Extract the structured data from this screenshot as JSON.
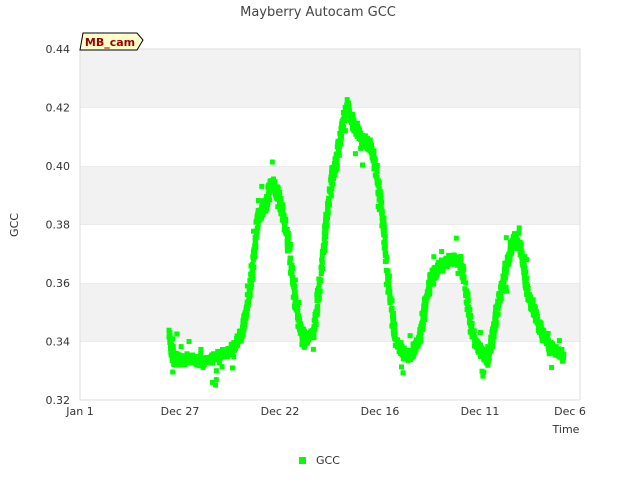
{
  "chart_data": {
    "type": "scatter",
    "title": "Mayberry Autocam GCC",
    "xlabel": "Time",
    "ylabel": "GCC",
    "x_tick_labels": [
      "Jan 1",
      "Dec 27",
      "Dec 22",
      "Dec 16",
      "Dec 11",
      "Dec 6"
    ],
    "y_tick_labels": [
      "0.32",
      "0.34",
      "0.36",
      "0.38",
      "0.40",
      "0.42",
      "0.44"
    ],
    "ylim": [
      0.32,
      0.44
    ],
    "xlim_days": [
      0,
      31
    ],
    "grid": "horizontal alternating bands",
    "legend_position": "bottom-center",
    "annotation": "MB_cam",
    "marker_color": "#00ff00",
    "series": [
      {
        "name": "GCC",
        "profile": [
          [
            5.5,
            0.3425
          ],
          [
            5.8,
            0.3345
          ],
          [
            6.3,
            0.3335
          ],
          [
            7.0,
            0.334
          ],
          [
            7.5,
            0.333
          ],
          [
            8.0,
            0.3335
          ],
          [
            8.5,
            0.335
          ],
          [
            9.0,
            0.336
          ],
          [
            9.5,
            0.338
          ],
          [
            10.0,
            0.342
          ],
          [
            10.5,
            0.356
          ],
          [
            10.8,
            0.37
          ],
          [
            11.0,
            0.382
          ],
          [
            11.5,
            0.387
          ],
          [
            11.9,
            0.394
          ],
          [
            12.3,
            0.39
          ],
          [
            12.7,
            0.38
          ],
          [
            13.0,
            0.37
          ],
          [
            13.3,
            0.356
          ],
          [
            13.6,
            0.345
          ],
          [
            14.0,
            0.34
          ],
          [
            14.5,
            0.344
          ],
          [
            14.8,
            0.356
          ],
          [
            15.2,
            0.378
          ],
          [
            15.6,
            0.395
          ],
          [
            16.0,
            0.405
          ],
          [
            16.3,
            0.415
          ],
          [
            16.6,
            0.42
          ],
          [
            17.0,
            0.414
          ],
          [
            17.5,
            0.409
          ],
          [
            18.0,
            0.407
          ],
          [
            18.4,
            0.398
          ],
          [
            18.8,
            0.38
          ],
          [
            19.0,
            0.365
          ],
          [
            19.3,
            0.35
          ],
          [
            19.6,
            0.34
          ],
          [
            20.0,
            0.336
          ],
          [
            20.5,
            0.335
          ],
          [
            20.8,
            0.338
          ],
          [
            21.1,
            0.342
          ],
          [
            21.4,
            0.352
          ],
          [
            21.8,
            0.362
          ],
          [
            22.3,
            0.366
          ],
          [
            23.0,
            0.368
          ],
          [
            23.6,
            0.367
          ],
          [
            23.9,
            0.358
          ],
          [
            24.2,
            0.346
          ],
          [
            24.5,
            0.34
          ],
          [
            25.0,
            0.336
          ],
          [
            25.3,
            0.333
          ],
          [
            25.6,
            0.342
          ],
          [
            26.0,
            0.355
          ],
          [
            26.5,
            0.368
          ],
          [
            27.0,
            0.376
          ],
          [
            27.4,
            0.37
          ],
          [
            27.8,
            0.356
          ],
          [
            28.2,
            0.35
          ],
          [
            28.7,
            0.342
          ],
          [
            29.2,
            0.338
          ],
          [
            29.7,
            0.336
          ],
          [
            30.0,
            0.335
          ]
        ]
      }
    ]
  }
}
